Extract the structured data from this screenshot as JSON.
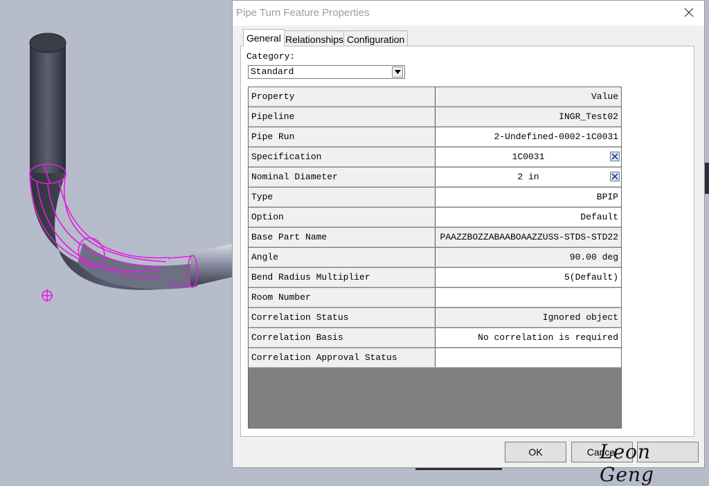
{
  "dialog": {
    "title": "Pipe Turn Feature Properties",
    "tabs": [
      {
        "label": "General",
        "active": true
      },
      {
        "label": "Relationships",
        "active": false
      },
      {
        "label": "Configuration",
        "active": false
      }
    ],
    "category": {
      "label": "Category:",
      "value": "Standard"
    },
    "grid": {
      "header": {
        "property": "Property",
        "value": "Value"
      },
      "rows": [
        {
          "property": "Pipeline",
          "value": "INGR_Test02"
        },
        {
          "property": "Pipe Run",
          "value": "2-Undefined-0002-1C0031"
        },
        {
          "property": "Specification",
          "value": "1C0031"
        },
        {
          "property": "Nominal Diameter",
          "value": "2 in"
        },
        {
          "property": "Type",
          "value": "BPIP"
        },
        {
          "property": "Option",
          "value": "Default"
        },
        {
          "property": "Base Part Name",
          "value": "PAAZZBOZZABAABOAAZZUSS-STDS-STD22"
        },
        {
          "property": "Angle",
          "value": "90.00 deg"
        },
        {
          "property": "Bend Radius Multiplier",
          "value": "5(Default)"
        },
        {
          "property": "Room Number",
          "value": ""
        },
        {
          "property": "Correlation Status",
          "value": "Ignored object"
        },
        {
          "property": "Correlation Basis",
          "value": "No correlation is required"
        },
        {
          "property": "Correlation Approval Status",
          "value": ""
        }
      ]
    },
    "buttons": {
      "ok": "OK",
      "cancel": "Cancel",
      "help": ""
    }
  },
  "watermark": "Leon Geng",
  "colors": {
    "highlight": "#e01fe0",
    "pipe": "#3f4350",
    "background": "#b7bccb"
  }
}
